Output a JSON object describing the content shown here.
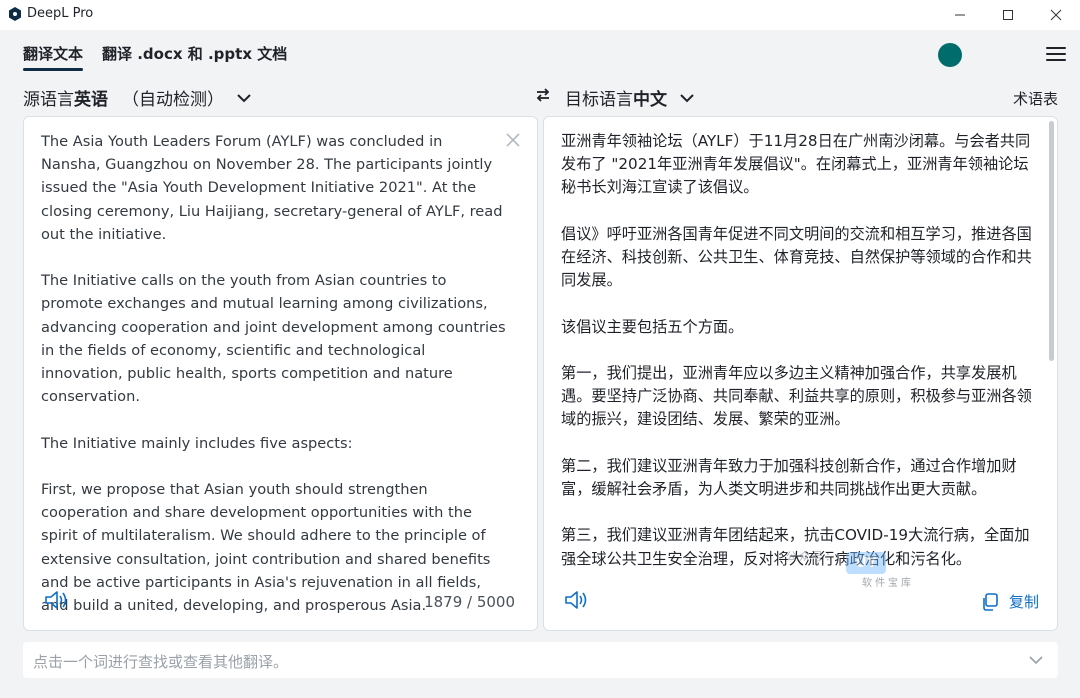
{
  "window": {
    "title": "DeepL Pro"
  },
  "nav": {
    "tabs": [
      {
        "label": "翻译文本"
      },
      {
        "label": "翻译 .docx 和 .pptx 文档"
      }
    ]
  },
  "lang": {
    "source_prefix": "源语言",
    "source_lang": "英语",
    "source_detect": "（自动检测）",
    "target_prefix": "目标语言",
    "target_lang": "中文",
    "glossary": "术语表"
  },
  "source": {
    "text": "The Asia Youth Leaders Forum (AYLF) was concluded in Nansha, Guangzhou on November 28. The participants jointly issued the \"Asia Youth Development Initiative 2021\". At the closing ceremony, Liu Haijiang, secretary-general of AYLF, read out the initiative.\n\nThe Initiative calls on the youth from Asian countries to promote exchanges and mutual learning among civilizations, advancing cooperation and joint development among countries in the fields of economy, scientific and technological innovation, public health, sports competition and nature conservation.\n\nThe Initiative mainly includes five aspects:\n\nFirst, we propose that Asian youth should strengthen cooperation and share development opportunities with the spirit of multilateralism. We should adhere to the principle of extensive consultation, joint contribution and shared benefits and be active participants in Asia's rejuvenation in all fields, and build a united, developing, and prosperous Asia.",
    "char_count": "1879 / 5000"
  },
  "target": {
    "text": "亚洲青年领袖论坛（AYLF）于11月28日在广州南沙闭幕。与会者共同发布了 \"2021年亚洲青年发展倡议\"。在闭幕式上，亚洲青年领袖论坛秘书长刘海江宣读了该倡议。\n\n倡议》呼吁亚洲各国青年促进不同文明间的交流和相互学习，推进各国在经济、科技创新、公共卫生、体育竞技、自然保护等领域的合作和共同发展。\n\n该倡议主要包括五个方面。\n\n第一，我们提出，亚洲青年应以多边主义精神加强合作，共享发展机遇。要坚持广泛协商、共同奉献、利益共享的原则，积极参与亚洲各领域的振兴，建设团结、发展、繁荣的亚洲。\n\n第二，我们建议亚洲青年致力于加强科技创新合作，通过合作增加财富，缓解社会矛盾，为人类文明进步和共同挑战作出更大贡献。\n\n第三，我们建议亚洲青年团结起来，抗击COVID-19大流行病，全面加强全球公共卫生安全治理，反对将大流行病政治化和污名化。",
    "copy_label": "复制"
  },
  "dictionary": {
    "placeholder": "点击一个词进行查找或查看其他翻译。"
  },
  "watermark": {
    "line1": "公众号：",
    "badge": "UY",
    "line2": "软件宝库"
  },
  "colors": {
    "accent": "#0f6fc6",
    "avatar": "#006d6d",
    "background": "#f2f3f5"
  }
}
